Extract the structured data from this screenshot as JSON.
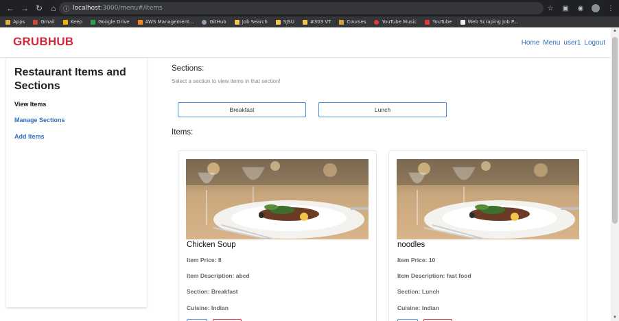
{
  "browser": {
    "url_host": "localhost",
    "url_path": ":3000/menu#/items",
    "bookmarks": [
      {
        "label": "Apps",
        "color": "#e8b33c"
      },
      {
        "label": "Gmail",
        "color": "#d44638"
      },
      {
        "label": "Keep",
        "color": "#f6b400"
      },
      {
        "label": "Google Drive",
        "color": "#2d9f4b"
      },
      {
        "label": "AWS Management...",
        "color": "#f28a22"
      },
      {
        "label": "GitHub",
        "color": "#9aa0a6"
      },
      {
        "label": "Job Search",
        "color": "#f2c94c"
      },
      {
        "label": "SJSU",
        "color": "#f2c94c"
      },
      {
        "label": "#303 VT",
        "color": "#f2c94c"
      },
      {
        "label": "Courses",
        "color": "#d9a33b"
      },
      {
        "label": "YouTube Music",
        "color": "#e53935"
      },
      {
        "label": "YouTube",
        "color": "#e53935"
      },
      {
        "label": "Web Scraping Job P...",
        "color": "#eeeeee"
      }
    ]
  },
  "navbar": {
    "brand": "GRUBHUB",
    "links": [
      "Home",
      "Menu",
      "user1",
      "Logout"
    ],
    "brand_color": "#d2283c",
    "link_color": "#2f6fbd"
  },
  "sidebar": {
    "title": "Restaurant Items and Sections",
    "items": [
      {
        "label": "View Items",
        "active": true
      },
      {
        "label": "Manage Sections",
        "active": false
      },
      {
        "label": "Add Items",
        "active": false
      }
    ]
  },
  "main": {
    "sections_title": "Sections:",
    "sections_help": "Select a section to view items in that section!",
    "section_buttons": [
      "Breakfast",
      "Lunch"
    ],
    "items_title": "Items:",
    "items": [
      {
        "name": "Chicken Soup",
        "price": "Item Price: 8",
        "description": "Item Description: abcd",
        "section": "Section: Breakfast",
        "cuisine": "Cuisine: Indian"
      },
      {
        "name": "noodles",
        "price": "Item Price: 10",
        "description": "Item Description: fast food",
        "section": "Section: Lunch",
        "cuisine": "Cuisine: Indian"
      }
    ]
  }
}
